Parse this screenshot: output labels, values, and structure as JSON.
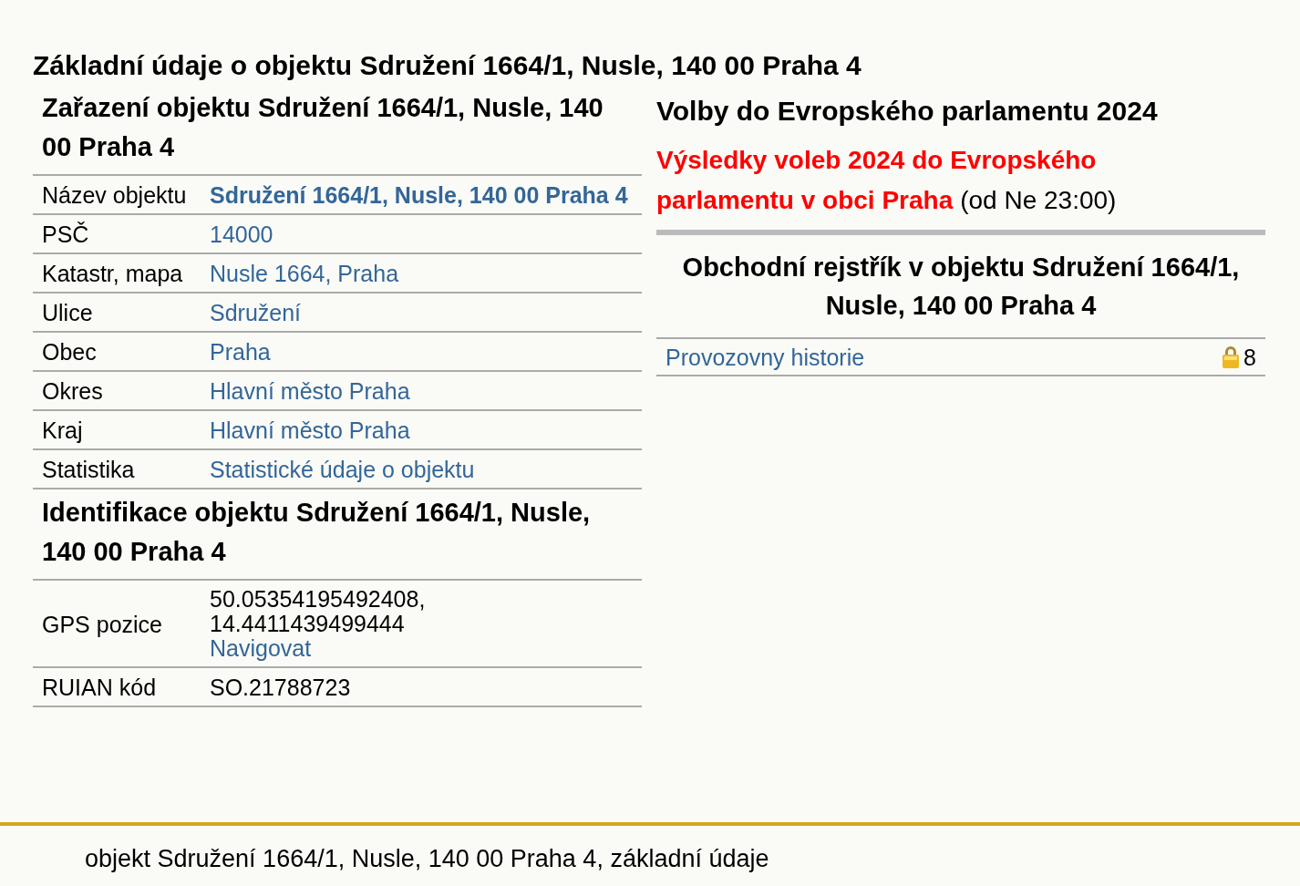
{
  "title": "Základní údaje o objektu Sdružení 1664/1, Nusle, 140 00 Praha 4",
  "sections": [
    {
      "heading": "Zařazení objektu Sdružení 1664/1, Nusle, 140 00 Praha 4",
      "rows": [
        {
          "label": "Název objektu",
          "values": [
            {
              "text": "Sdružení 1664/1, Nusle, 140 00 Praha 4",
              "kind": "strong_link"
            }
          ]
        },
        {
          "label": "PSČ",
          "values": [
            {
              "text": "14000",
              "kind": "link"
            }
          ]
        },
        {
          "label": "Katastr, mapa",
          "values": [
            {
              "text": "Nusle 1664, Praha",
              "kind": "link"
            }
          ]
        },
        {
          "label": "Ulice",
          "values": [
            {
              "text": "Sdružení",
              "kind": "link"
            }
          ]
        },
        {
          "label": "Obec",
          "values": [
            {
              "text": "Praha",
              "kind": "link"
            }
          ]
        },
        {
          "label": "Okres",
          "values": [
            {
              "text": "Hlavní město Praha",
              "kind": "link"
            }
          ]
        },
        {
          "label": "Kraj",
          "values": [
            {
              "text": "Hlavní město Praha",
              "kind": "link"
            }
          ]
        },
        {
          "label": "Statistika",
          "values": [
            {
              "text": "Statistické údaje o objektu",
              "kind": "link"
            }
          ]
        }
      ]
    },
    {
      "heading": "Identifikace objektu Sdružení 1664/1, Nusle, 140 00 Praha 4",
      "rows": [
        {
          "label": "GPS pozice",
          "values": [
            {
              "text": "50.05354195492408,",
              "kind": "text"
            },
            {
              "text": "14.4411439499444",
              "kind": "text"
            },
            {
              "text": "Navigovat",
              "kind": "link"
            }
          ]
        },
        {
          "label": "RUIAN kód",
          "values": [
            {
              "text": "SO.21788723",
              "kind": "text"
            }
          ]
        }
      ]
    }
  ],
  "elections": {
    "heading": "Volby do Evropského parlamentu 2024",
    "link_lines": [
      "Výsledky voleb 2024 do Evropského",
      "parlamentu v obci Praha"
    ],
    "note": "(od Ne 23:00)"
  },
  "registry": {
    "heading": "Obchodní rejstřík v objektu Sdružení 1664/1, Nusle, 140 00 Praha 4",
    "rows": [
      {
        "label": "Provozovny historie",
        "count": "8",
        "locked": true
      }
    ]
  },
  "footer": "objekt Sdružení 1664/1, Nusle, 140 00 Praha 4, základní údaje"
}
